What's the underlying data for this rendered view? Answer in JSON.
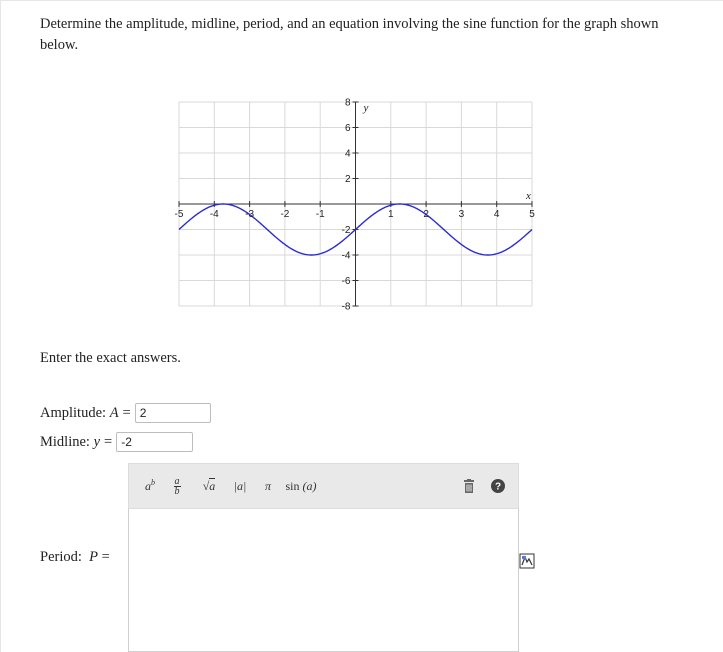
{
  "question": {
    "text": "Determine the amplitude, midline, period, and an equation involving the sine function for the graph shown below."
  },
  "graph": {
    "x_tick_labels": [
      "-5",
      "-4",
      "-3",
      "-2",
      "-1",
      "1",
      "2",
      "3",
      "4",
      "5"
    ],
    "y_tick_labels": [
      "8",
      "6",
      "4",
      "2",
      "-2",
      "-4",
      "-6",
      "-8"
    ],
    "x_axis_label": "x",
    "y_axis_label": "y",
    "curve_color": "#2b2bd6",
    "x_range": [
      -5,
      5
    ],
    "y_range": [
      -8,
      8
    ],
    "curve": {
      "amplitude": 2,
      "midline": -2,
      "period": 5,
      "phase_peak_x": -3.75
    }
  },
  "instructions": {
    "text": "Enter the exact answers."
  },
  "amplitude": {
    "label_prefix": "Amplitude:",
    "var": "A",
    "eq": "=",
    "value": "2"
  },
  "midline": {
    "label_prefix": "Midline:",
    "var": "y",
    "eq": "=",
    "value": "-2"
  },
  "period": {
    "label_prefix": "Period:",
    "var": "P",
    "eq": "="
  },
  "toolbar": {
    "exponent": {
      "base": "a",
      "sup": "b"
    },
    "fraction": {
      "num": "a",
      "den": "b"
    },
    "sqrt": {
      "sym": "√",
      "arg": "a"
    },
    "abs": {
      "text": "|a|"
    },
    "pi": {
      "text": "π"
    },
    "sin": {
      "fn": "sin",
      "arg": "(a)"
    },
    "icons": [
      "exponent-icon",
      "fraction-icon",
      "sqrt-icon",
      "abs-icon",
      "pi-icon",
      "sin-icon",
      "trash-icon",
      "help-icon"
    ]
  }
}
